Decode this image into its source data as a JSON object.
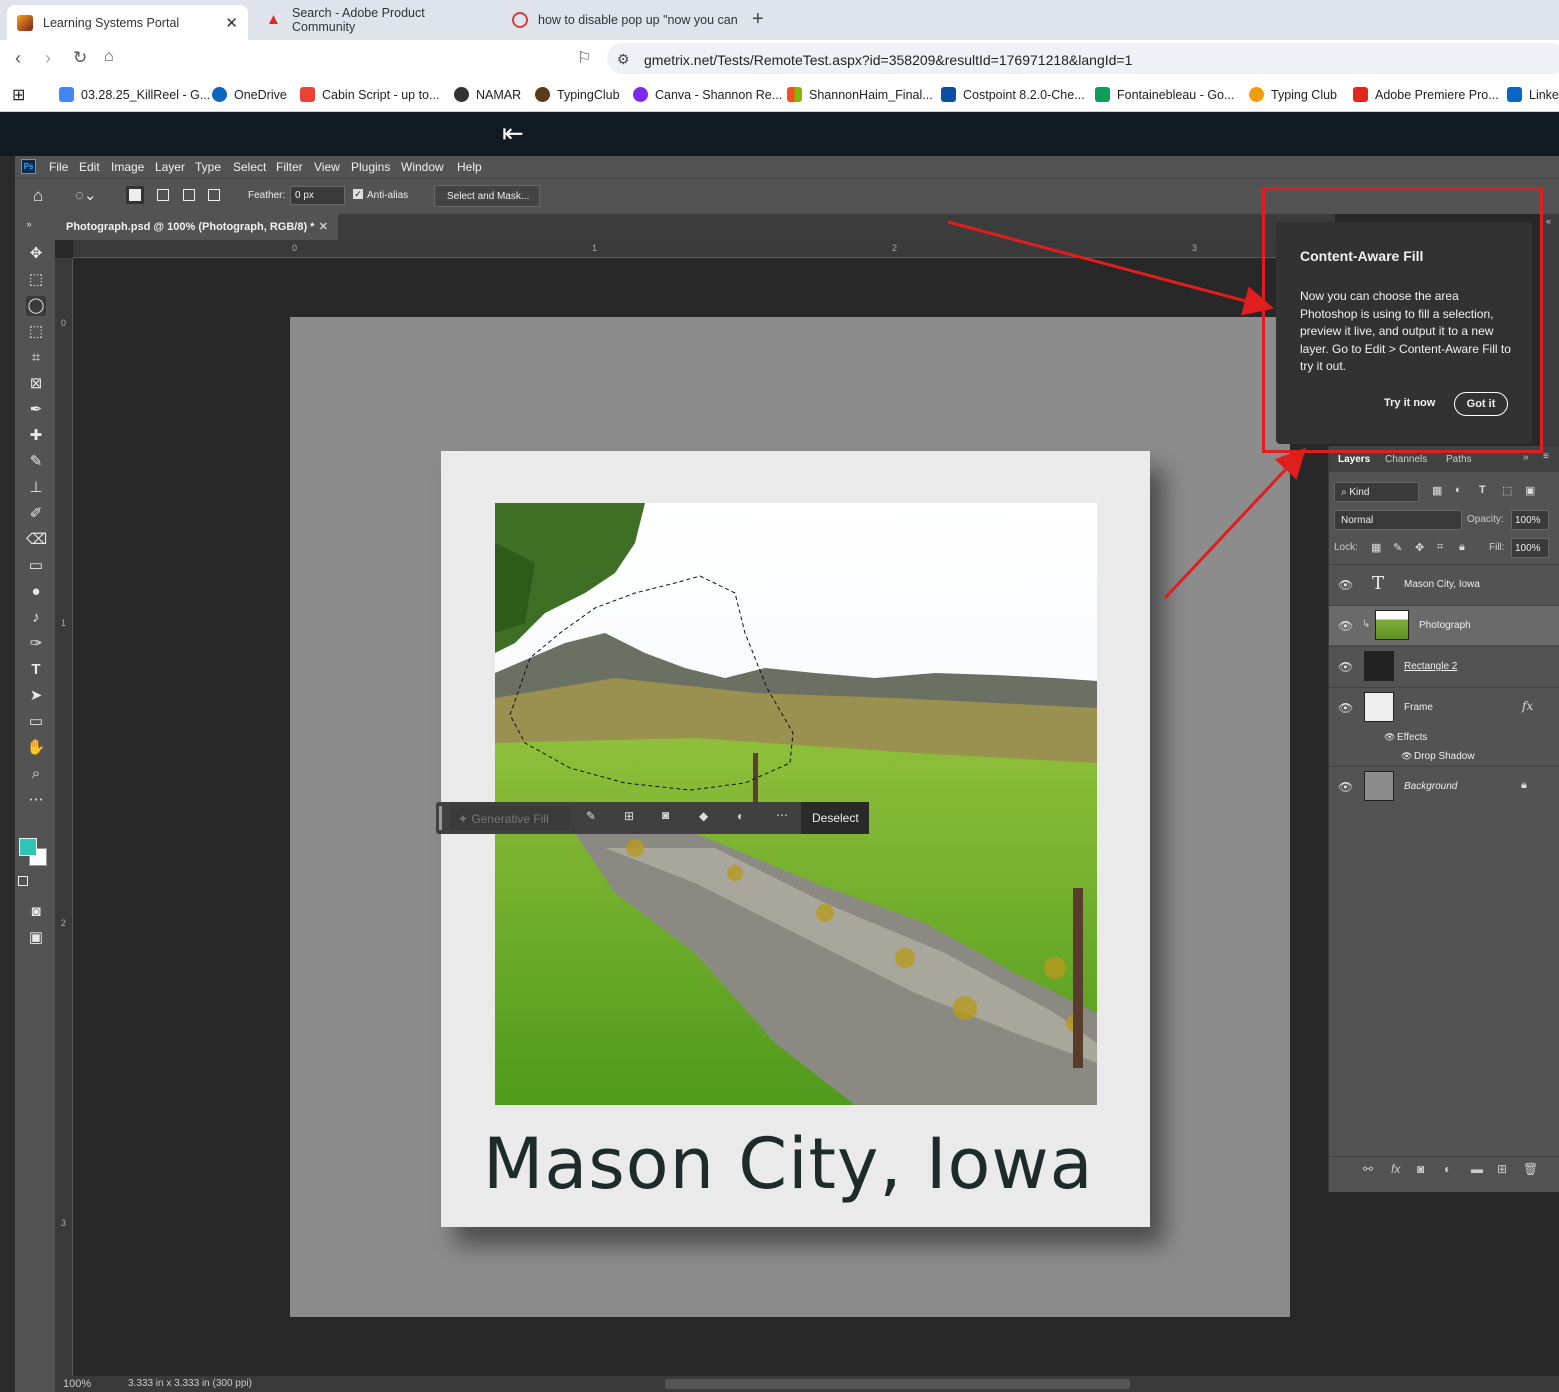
{
  "browser": {
    "tabs": [
      {
        "title": "Learning Systems Portal",
        "active": true
      },
      {
        "title": "Search - Adobe Product Community"
      },
      {
        "title": "how to disable pop up \"now you can"
      }
    ],
    "url": "gmetrix.net/Tests/RemoteTest.aspx?id=358209&resultId=176971218&langId=1",
    "bookmarks": [
      "03.28.25_KillReel - G...",
      "OneDrive",
      "Cabin Script - up to...",
      "NAMAR",
      "TypingClub",
      "Canva - Shannon Re...",
      "ShannonHaim_Final...",
      "Costpoint 8.2.0-Che...",
      "Fontainebleau - Go...",
      "Typing Club",
      "Adobe Premiere Pro...",
      "Linked"
    ]
  },
  "ps": {
    "menu": [
      "File",
      "Edit",
      "Image",
      "Layer",
      "Type",
      "Select",
      "Filter",
      "View",
      "Plugins",
      "Window",
      "Help"
    ],
    "options": {
      "feather_label": "Feather:",
      "feather_value": "0 px",
      "antialias": "Anti-alias",
      "select_mask": "Select and Mask..."
    },
    "doc_tab": "Photograph.psd @ 100% (Photograph, RGB/8) *",
    "ruler_h": [
      "0",
      "1",
      "2",
      "3"
    ],
    "ruler_v": [
      "0",
      "1",
      "2",
      "3"
    ],
    "canvas_text": "Mason City, Iowa",
    "context_bar": {
      "generative_fill": "Generative Fill",
      "deselect": "Deselect"
    },
    "status": {
      "zoom": "100%",
      "size": "3.333 in x 3.333 in (300 ppi)"
    },
    "popup": {
      "title": "Content-Aware Fill",
      "body": "Now you can choose the area Photoshop is using to fill a selection, preview it live, and output it to a new layer. Go to Edit > Content-Aware Fill to try it out.",
      "try_now": "Try it now",
      "got_it": "Got it"
    },
    "layers_panel": {
      "tabs": [
        "Layers",
        "Channels",
        "Paths"
      ],
      "kind": "Kind",
      "blend": "Normal",
      "opacity_label": "Opacity:",
      "opacity": "100%",
      "lock_label": "Lock:",
      "fill_label": "Fill:",
      "fill": "100%",
      "layers": [
        "Mason City, Iowa",
        "Photograph",
        "Rectangle 2",
        "Frame",
        "Background"
      ],
      "effects": "Effects",
      "drop_shadow": "Drop Shadow"
    }
  },
  "colors": {
    "accent": "#e01e1e",
    "foreground": "#2ec4b6"
  }
}
